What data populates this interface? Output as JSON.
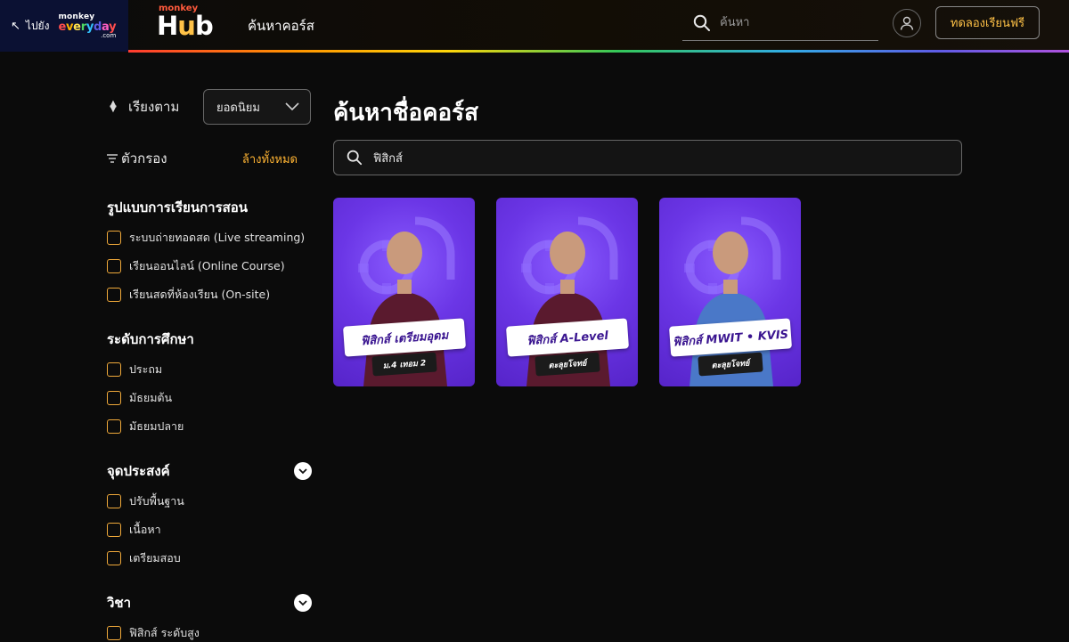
{
  "header": {
    "back_arrow": "↖",
    "back_label": "ไปยัง",
    "me_logo": {
      "line1": "monkey",
      "line2": "everyday",
      "line3": ".com"
    },
    "hub_logo": {
      "small": "monkey",
      "big": "Hub"
    },
    "nav_search_courses": "ค้นหาคอร์ส",
    "search_placeholder": "ค้นหา",
    "trial_button": "ทดลองเรียนฟรี"
  },
  "sidebar": {
    "sort_label": "เรียงตาม",
    "sort_value": "ยอดนิยม",
    "filter_label": "ตัวกรอง",
    "clear_all": "ล้างทั้งหมด",
    "groups": [
      {
        "title": "รูปแบบการเรียนการสอน",
        "collapsible": false,
        "options": [
          "ระบบถ่ายทอดสด (Live streaming)",
          "เรียนออนไลน์ (Online Course)",
          "เรียนสดที่ห้องเรียน (On-site)"
        ]
      },
      {
        "title": "ระดับการศึกษา",
        "collapsible": false,
        "options": [
          "ประถม",
          "มัธยมต้น",
          "มัธยมปลาย"
        ]
      },
      {
        "title": "จุดประสงค์",
        "collapsible": true,
        "options": [
          "ปรับพื้นฐาน",
          "เนื้อหา",
          "เตรียมสอบ"
        ]
      },
      {
        "title": "วิชา",
        "collapsible": true,
        "options": [
          "ฟิสิกส์ ระดับสูง"
        ]
      }
    ]
  },
  "main": {
    "title": "ค้นหาชื่อคอร์ส",
    "search_value": "ฟิสิกส์",
    "cards": [
      {
        "title": "ฟิสิกส์ เตรียมอุดม",
        "subtitle": "ม.4 เทอม 2",
        "shirt": "#5a1a2e"
      },
      {
        "title": "ฟิสิกส์ A-Level",
        "subtitle": "ตะลุยโจทย์",
        "shirt": "#5a1a2e"
      },
      {
        "title": "ฟิสิกส์ MWIT • KVIS",
        "subtitle": "ตะลุยโจทย์",
        "shirt": "#4a78c8"
      }
    ]
  },
  "colors": {
    "accent": "#ffb433",
    "brand_yellow": "#ffc247",
    "card_purple": "#6b36e6",
    "background": "#0b0b0b"
  },
  "icons": {
    "back": "arrow-up-left-icon",
    "search": "search-icon",
    "user": "user-icon",
    "sort": "sort-icon",
    "filter": "filter-icon",
    "chevron": "chevron-down-icon"
  }
}
